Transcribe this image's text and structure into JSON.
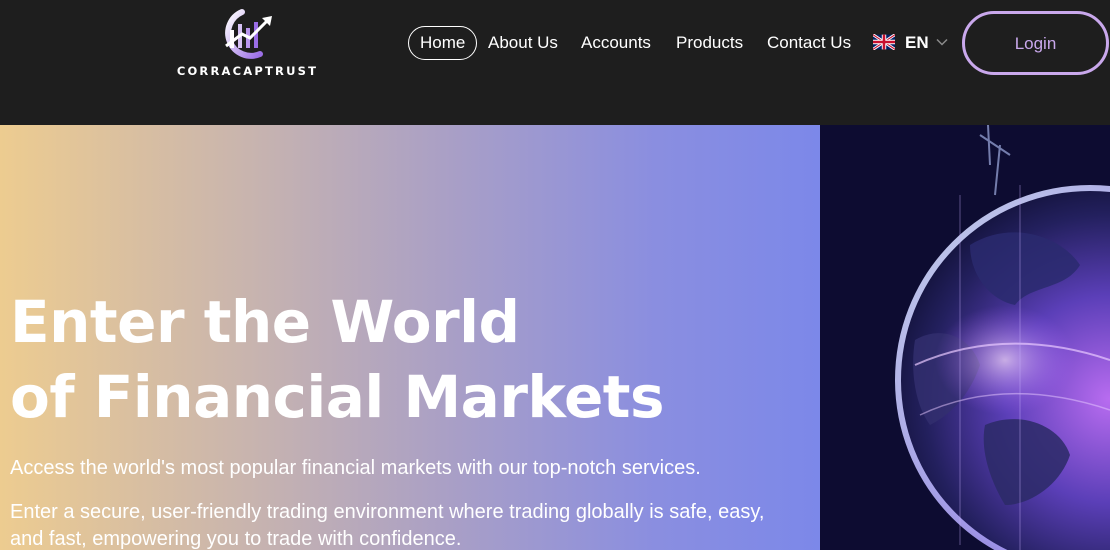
{
  "brand": {
    "name": "CORRACAPTRUST"
  },
  "nav": {
    "items": [
      {
        "label": "Home",
        "active": true
      },
      {
        "label": "About Us"
      },
      {
        "label": "Accounts"
      },
      {
        "label": "Products"
      },
      {
        "label": "Contact Us"
      }
    ],
    "language": {
      "code": "EN",
      "flag_icon": "uk-flag-icon"
    },
    "login_label": "Login"
  },
  "hero": {
    "title_line1": "Enter the World",
    "title_line2": "of Financial Markets",
    "subtitle": "Access the world's most popular financial markets with our top-notch services.",
    "description": "Enter a secure, user-friendly trading environment where trading globally is safe, easy, and fast, empowering you to trade with confidence."
  },
  "colors": {
    "header_bg": "#1e1e1e",
    "accent": "#c9a8ec",
    "gradient_start": "#edcc90",
    "gradient_end": "#7c88e9",
    "globe_bg": "#0c0a2a"
  }
}
